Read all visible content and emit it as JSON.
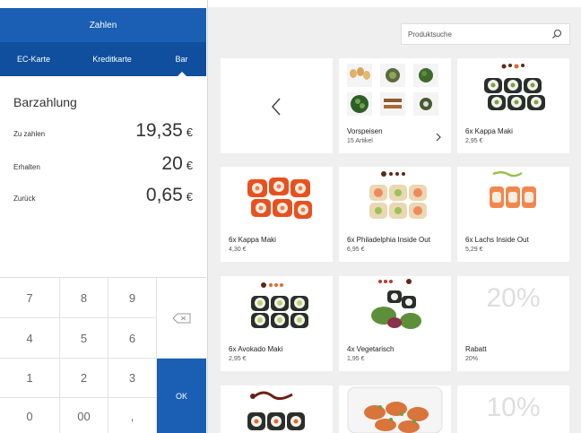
{
  "panel": {
    "title": "Zahlen",
    "tabs": [
      "EC-Karte",
      "Kreditkarte",
      "Bar"
    ],
    "section_title": "Barzahlung",
    "rows": [
      {
        "label": "Zu zahlen",
        "value": "19,35",
        "currency": "€"
      },
      {
        "label": "Erhalten",
        "value": "20",
        "currency": "€"
      },
      {
        "label": "Zurück",
        "value": "0,65",
        "currency": "€"
      }
    ],
    "keys": [
      "7",
      "8",
      "9",
      "4",
      "5",
      "6",
      "1",
      "2",
      "3",
      "0",
      "00",
      ","
    ],
    "ok_label": "OK"
  },
  "search": {
    "placeholder": "Produktsuche"
  },
  "products": [
    {
      "name": "Vorspeisen",
      "sub": "15 Artikel"
    },
    {
      "name": "6x Kappa Maki",
      "sub": "2,95 €"
    },
    {
      "name": "6x Kappa Maki",
      "sub": "4,30 €"
    },
    {
      "name": "6x Philadelphia Inside Out",
      "sub": "6,95 €"
    },
    {
      "name": "6x Lachs Inside Out",
      "sub": "5,29 €"
    },
    {
      "name": "6x Avokado Maki",
      "sub": "2,95 €"
    },
    {
      "name": "4x Vegetarisch",
      "sub": "1,95 €"
    },
    {
      "name": "Rabatt",
      "sub": "20%",
      "badge": "20%"
    },
    {
      "name": "",
      "sub": "",
      "badge": "10%"
    }
  ],
  "colors": {
    "accent": "#1a5fb4",
    "accent_dark": "#0f4f9e",
    "background": "#efefef"
  }
}
